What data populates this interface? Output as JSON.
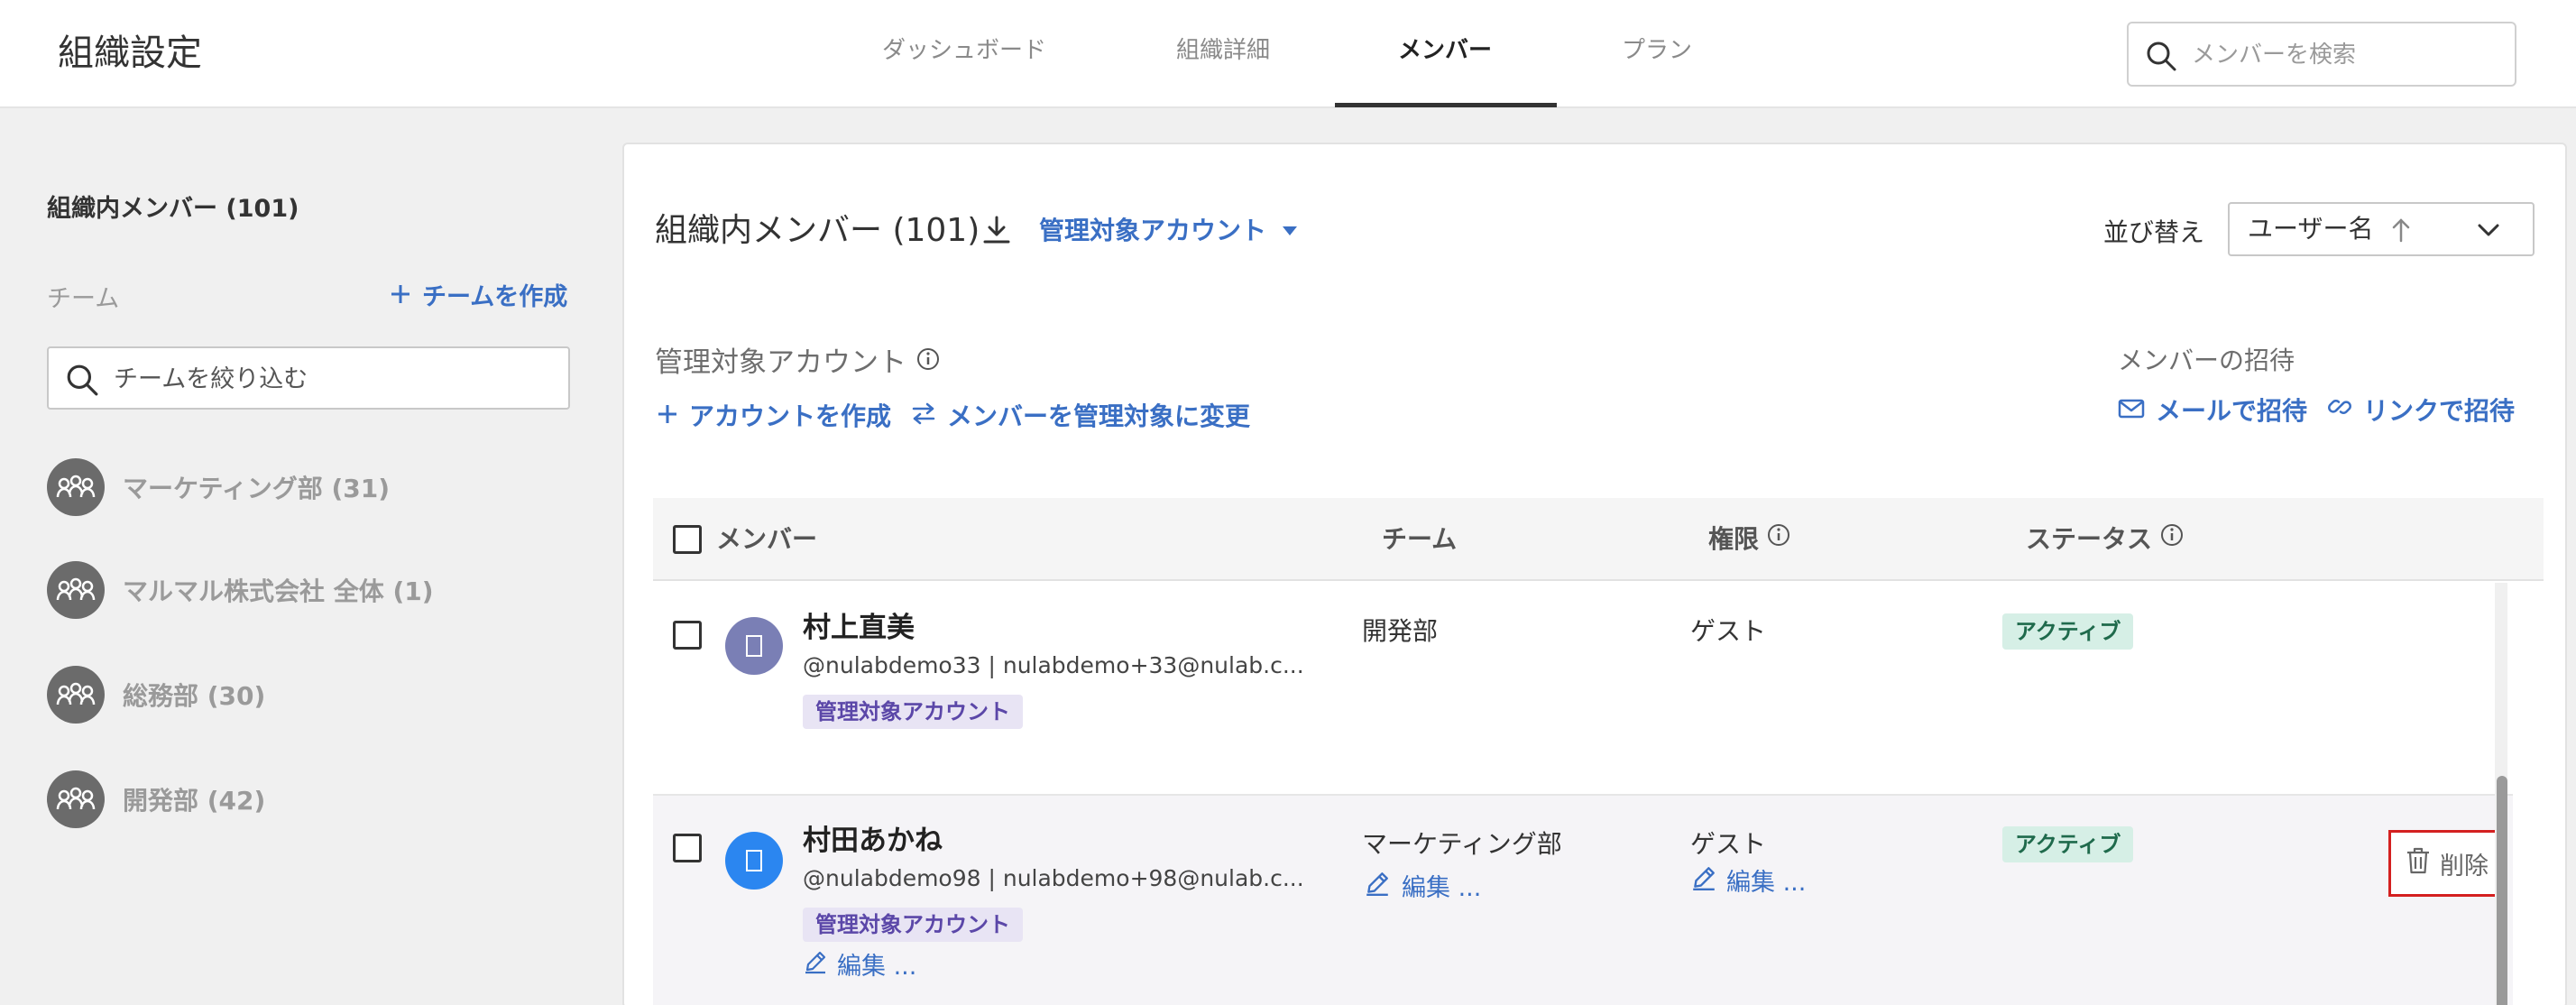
{
  "header": {
    "title": "組織設定",
    "tabs": [
      {
        "label": "ダッシュボード"
      },
      {
        "label": "組織詳細"
      },
      {
        "label": "メンバー"
      },
      {
        "label": "プラン"
      }
    ],
    "search_placeholder": "メンバーを検索"
  },
  "sidebar": {
    "heading": "組織内メンバー (101)",
    "team_label": "チーム",
    "create_team_label": "チームを作成",
    "filter_placeholder": "チームを絞り込む",
    "teams": [
      {
        "name": "マーケティング部 (31)"
      },
      {
        "name": "マルマル株式会社 全体 (1)"
      },
      {
        "name": "総務部 (30)"
      },
      {
        "name": "開発部 (42)"
      }
    ]
  },
  "main": {
    "title": "組織内メンバー (101)",
    "managed_filter": "管理対象アカウント",
    "sort_label": "並び替え",
    "sort_value": "ユーザー名",
    "managed_accounts_label": "管理対象アカウント",
    "create_account": "アカウントを作成",
    "change_managed": "メンバーを管理対象に変更",
    "invite_label": "メンバーの招待",
    "invite_email": "メールで招待",
    "invite_link": "リンクで招待",
    "columns": {
      "member": "メンバー",
      "team": "チーム",
      "permission": "権限",
      "status": "ステータス"
    },
    "rows": [
      {
        "name": "村上直美",
        "sub": "@nulabdemo33 | nulabdemo+33@nulab.c...",
        "badge": "管理対象アカウント",
        "team": "開発部",
        "permission": "ゲスト",
        "status": "アクティブ"
      },
      {
        "name": "村田あかね",
        "sub": "@nulabdemo98 | nulabdemo+98@nulab.c...",
        "badge": "管理対象アカウント",
        "team": "マーケティング部",
        "permission": "ゲスト",
        "status": "アクティブ",
        "edit_label": "編集 ...",
        "delete_label": "削除"
      }
    ]
  },
  "colors": {
    "accent": "#3a6fc4",
    "badge_bg": "#e8e4f4",
    "status_bg": "#d6efe6",
    "delete_border": "#d42020",
    "avatar1": "#7a7fb5",
    "avatar2": "#2b86f0"
  }
}
